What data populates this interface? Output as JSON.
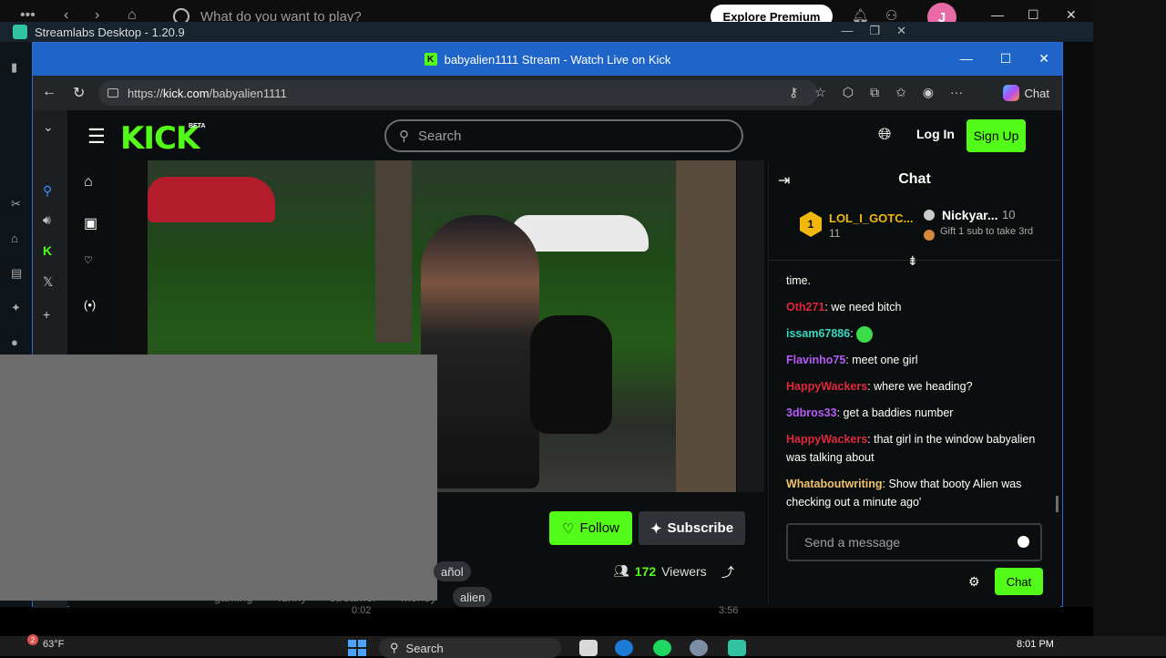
{
  "background_app": {
    "search_placeholder": "What do you want to play?",
    "explore_label": "Explore Premium",
    "avatar_initial": "J"
  },
  "streamlabs": {
    "title": "Streamlabs Desktop - 1.20.9"
  },
  "browser": {
    "window_title": "babyalien1111 Stream - Watch Live on Kick",
    "url_prefix": "https://",
    "url_host": "kick.com",
    "url_path": "/babyalien1111",
    "copilot_label": "Chat"
  },
  "kick": {
    "logo": "KICK",
    "beta": "BETA",
    "search_placeholder": "Search",
    "login_label": "Log In",
    "signup_label": "Sign Up",
    "follow_label": "Follow",
    "subscribe_label": "Subscribe",
    "viewers_count": "172",
    "viewers_label": "Viewers",
    "tags": [
      "añol",
      "alien"
    ],
    "ghost_tags": [
      "gaming",
      "funny",
      "streamer",
      "money"
    ],
    "time_elapsed": "0:02",
    "time_total": "3:56"
  },
  "chat": {
    "title": "Chat",
    "leaderboard": {
      "first_name": "LOL_I_GOTC...",
      "first_count": "11",
      "second_name": "Nickyar...",
      "second_count": "10",
      "third_text": "Gift 1 sub to take 3rd"
    },
    "messages": [
      {
        "user": "",
        "color": "#ffffff",
        "text": "time."
      },
      {
        "user": "Oth271",
        "color": "#e0283c",
        "text": "we need bitch"
      },
      {
        "user": "issam67886",
        "color": "#37d8c0",
        "text": ""
      },
      {
        "user": "Flavinho75",
        "color": "#b55cf7",
        "text": "meet one girl"
      },
      {
        "user": "HappyWackers",
        "color": "#e0283c",
        "text": "where we heading?"
      },
      {
        "user": "3dbros33",
        "color": "#b55cf7",
        "text": "get a baddies number"
      },
      {
        "user": "HappyWackers",
        "color": "#e0283c",
        "text": "that girl in the window babyalien was talking about"
      },
      {
        "user": "Whataboutwriting",
        "color": "#f2c26b",
        "text": "Show that booty Alien was checking out a minute ago'"
      }
    ],
    "send_placeholder": "Send a message",
    "chat_button": "Chat"
  },
  "taskbar": {
    "weather_temp": "63°F",
    "weather_badge": "2",
    "search_label": "Search",
    "time": "8:01 PM"
  },
  "colors": {
    "kick_green": "#53fc18",
    "window_blue": "#1f64c8"
  }
}
